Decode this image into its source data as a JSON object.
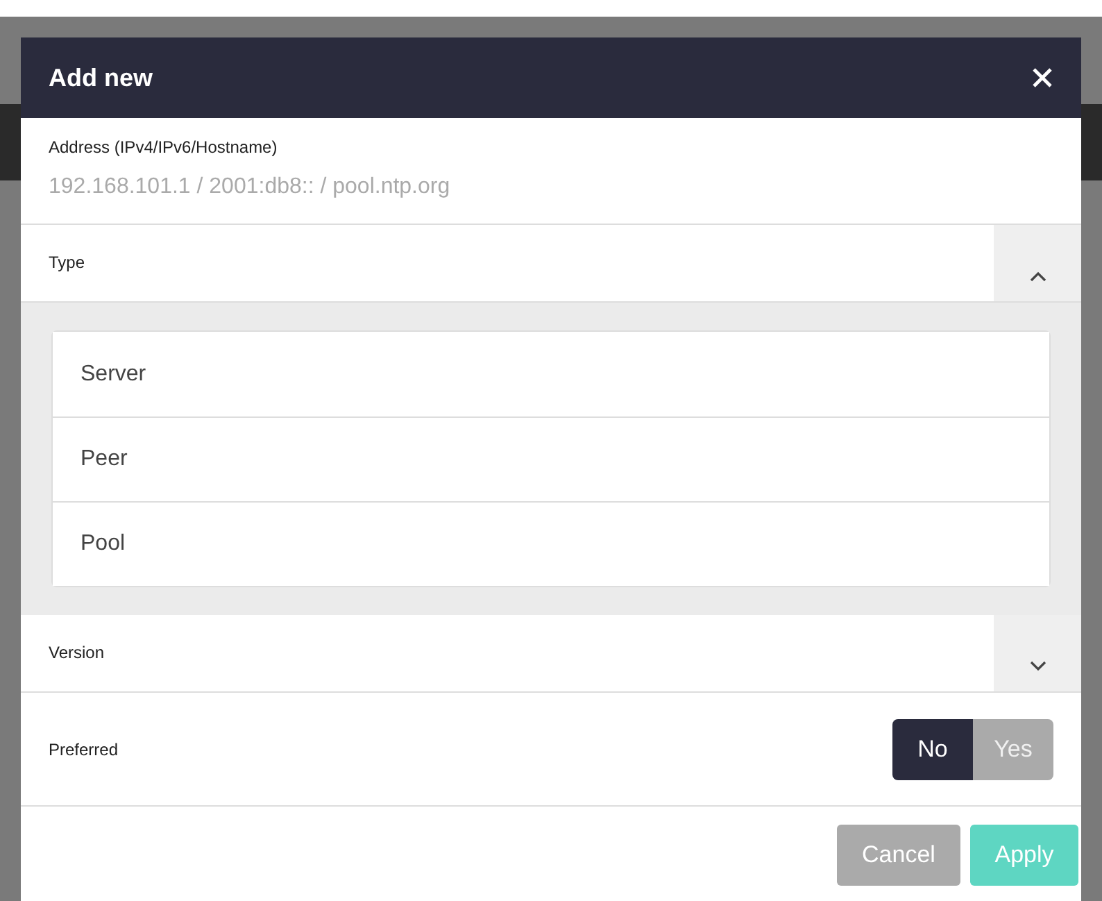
{
  "dialog": {
    "title": "Add new"
  },
  "address": {
    "label": "Address (IPv4/IPv6/Hostname)",
    "placeholder": "192.168.101.1 / 2001:db8:: / pool.ntp.org"
  },
  "type": {
    "label": "Type",
    "expanded": true,
    "options": [
      {
        "label": "Server",
        "selected": false
      },
      {
        "label": "Peer",
        "selected": false
      },
      {
        "label": "Pool",
        "selected": false
      }
    ]
  },
  "version": {
    "label": "Version",
    "expanded": false
  },
  "preferred": {
    "label": "Preferred",
    "options": [
      {
        "label": "No",
        "selected": true
      },
      {
        "label": "Yes",
        "selected": false
      }
    ]
  },
  "buttons": [
    {
      "label": "Cancel",
      "kind": "cancel"
    },
    {
      "label": "Apply",
      "kind": "apply"
    }
  ]
}
